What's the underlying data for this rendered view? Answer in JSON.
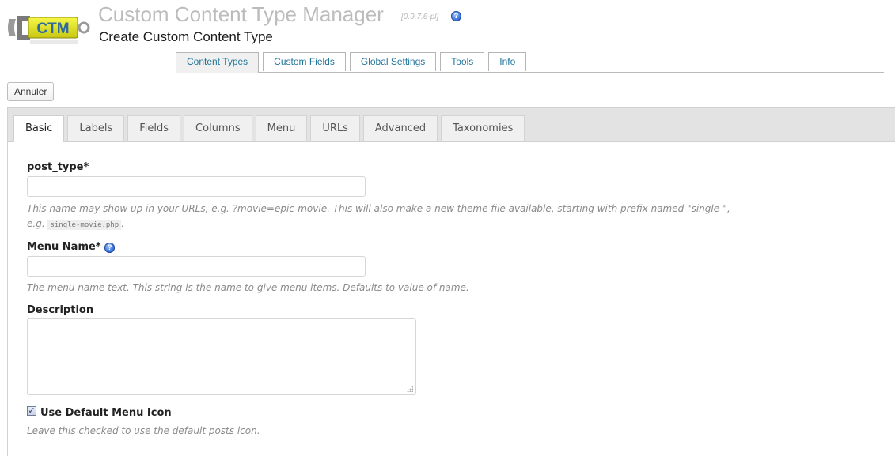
{
  "header": {
    "logo_text": "CTM",
    "app_title": "Custom Content Type Manager",
    "version": "[0.9.7.6-pl]",
    "page_title": "Create Custom Content Type"
  },
  "nav": {
    "tabs": [
      {
        "label": "Content Types",
        "active": true
      },
      {
        "label": "Custom Fields",
        "active": false
      },
      {
        "label": "Global Settings",
        "active": false
      },
      {
        "label": "Tools",
        "active": false
      },
      {
        "label": "Info",
        "active": false
      }
    ]
  },
  "cancel_label": "Annuler",
  "form_tabs": [
    {
      "label": "Basic",
      "active": true
    },
    {
      "label": "Labels",
      "active": false
    },
    {
      "label": "Fields",
      "active": false
    },
    {
      "label": "Columns",
      "active": false
    },
    {
      "label": "Menu",
      "active": false
    },
    {
      "label": "URLs",
      "active": false
    },
    {
      "label": "Advanced",
      "active": false
    },
    {
      "label": "Taxonomies",
      "active": false
    }
  ],
  "fields": {
    "post_type": {
      "label": "post_type*",
      "value": "",
      "hint_line1": "This name may show up in your URLs, e.g. ?movie=epic-movie. This will also make a new theme file available, starting with prefix named \"single-\",",
      "hint_line2_prefix": "e.g.",
      "hint_code": "single-movie.php",
      "hint_line2_suffix": "."
    },
    "menu_name": {
      "label": "Menu Name*",
      "value": "",
      "hint": "The menu name text. This string is the name to give menu items. Defaults to value of name."
    },
    "description": {
      "label": "Description",
      "value": ""
    },
    "use_default_menu_icon": {
      "label": "Use Default Menu Icon",
      "checked": true,
      "hint": "Leave this checked to use the default posts icon."
    }
  },
  "colors": {
    "link": "#21759b",
    "tabbar": "#e3e3e3",
    "hint": "#8a8a8a",
    "title_gray": "#bcbcbc"
  },
  "icons": {
    "help": "help-icon",
    "logo": "ctm-logo",
    "checkbox": "checkbox-checked-icon",
    "resize": "resize-grip-icon"
  }
}
